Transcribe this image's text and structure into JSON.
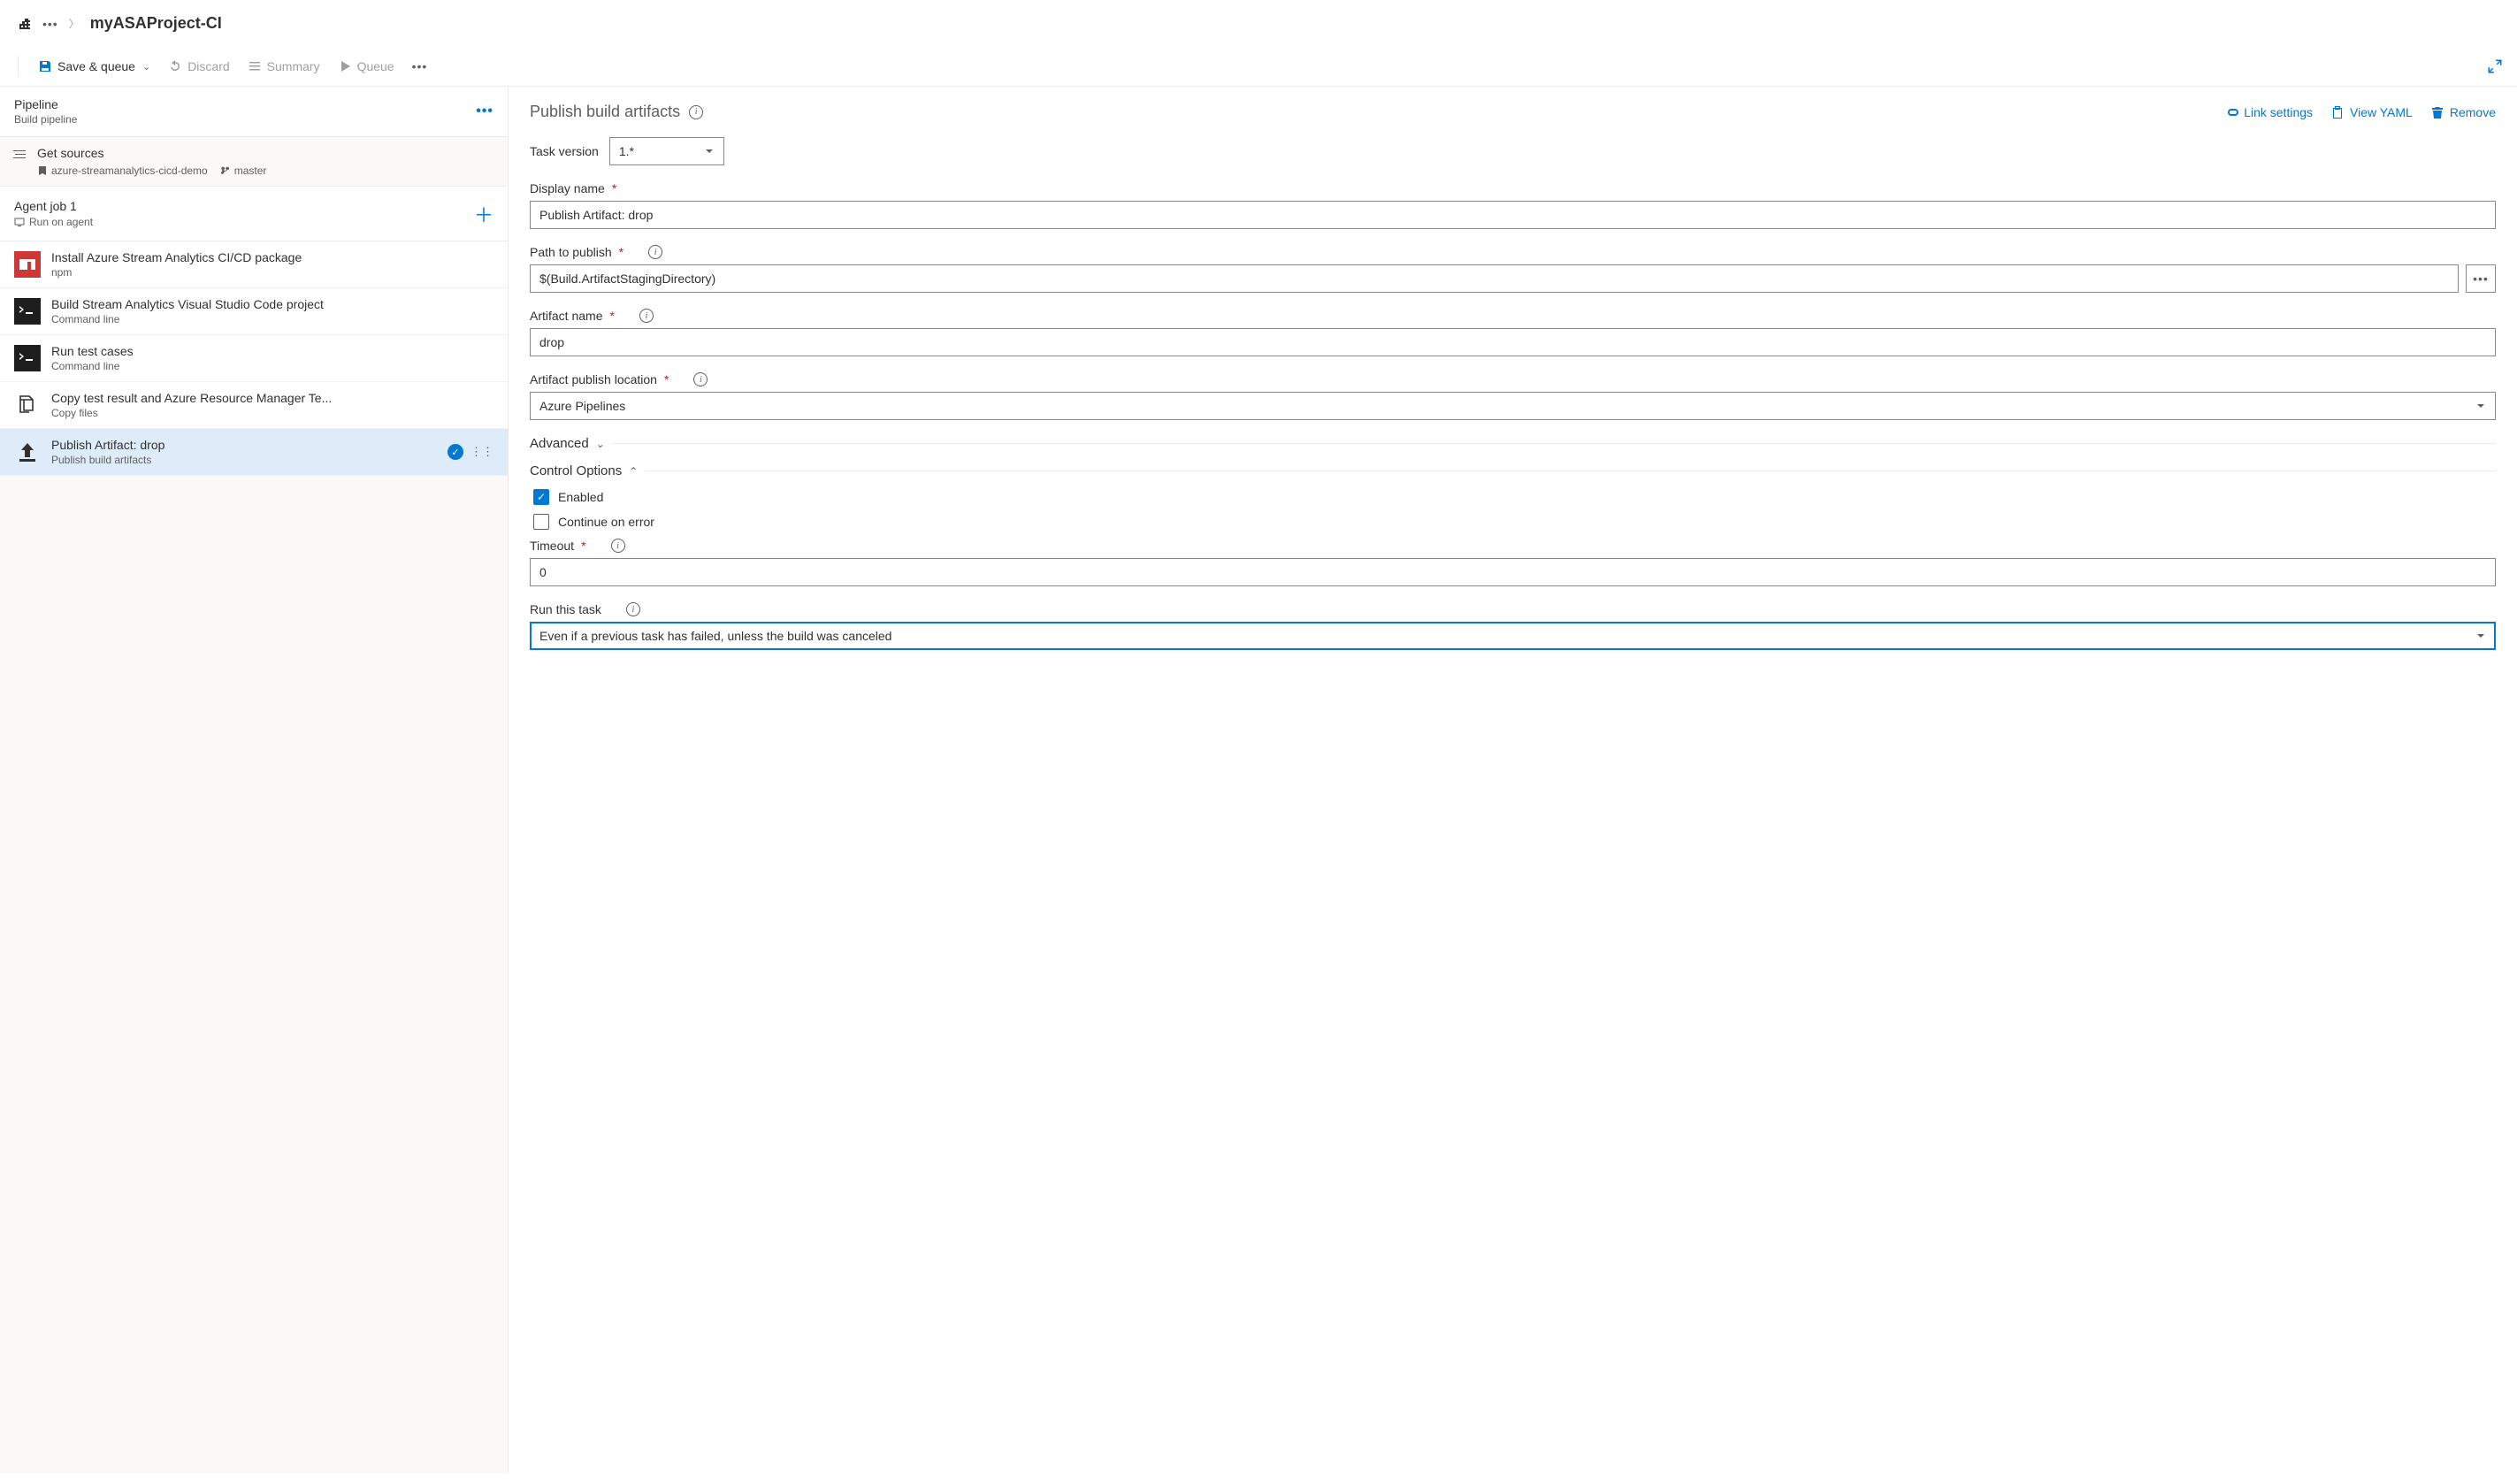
{
  "breadcrumb": {
    "title": "myASAProject-CI"
  },
  "toolbar": {
    "save_queue": "Save & queue",
    "discard": "Discard",
    "summary": "Summary",
    "queue": "Queue"
  },
  "left": {
    "pipeline": {
      "title": "Pipeline",
      "subtitle": "Build pipeline"
    },
    "sources": {
      "title": "Get sources",
      "repo": "azure-streamanalytics-cicd-demo",
      "branch": "master"
    },
    "agent": {
      "title": "Agent job 1",
      "subtitle": "Run on agent"
    },
    "tasks": [
      {
        "name": "Install Azure Stream Analytics CI/CD package",
        "sub": "npm",
        "icon": "npm"
      },
      {
        "name": "Build Stream Analytics Visual Studio Code project",
        "sub": "Command line",
        "icon": "cmd"
      },
      {
        "name": "Run test cases",
        "sub": "Command line",
        "icon": "cmd"
      },
      {
        "name": "Copy test result and Azure Resource Manager Te...",
        "sub": "Copy files",
        "icon": "copy"
      },
      {
        "name": "Publish Artifact: drop",
        "sub": "Publish build artifacts",
        "icon": "publish"
      }
    ]
  },
  "right": {
    "title": "Publish build artifacts",
    "actions": {
      "link_settings": "Link settings",
      "view_yaml": "View YAML",
      "remove": "Remove"
    },
    "task_version": {
      "label": "Task version",
      "value": "1.*"
    },
    "display_name": {
      "label": "Display name",
      "value": "Publish Artifact: drop"
    },
    "path_to_publish": {
      "label": "Path to publish",
      "value": "$(Build.ArtifactStagingDirectory)"
    },
    "artifact_name": {
      "label": "Artifact name",
      "value": "drop"
    },
    "publish_location": {
      "label": "Artifact publish location",
      "value": "Azure Pipelines"
    },
    "sections": {
      "advanced": "Advanced",
      "control_options": "Control Options"
    },
    "control": {
      "enabled": "Enabled",
      "continue_on_error": "Continue on error",
      "timeout": {
        "label": "Timeout",
        "value": "0"
      },
      "run_task": {
        "label": "Run this task",
        "value": "Even if a previous task has failed, unless the build was canceled"
      }
    }
  }
}
